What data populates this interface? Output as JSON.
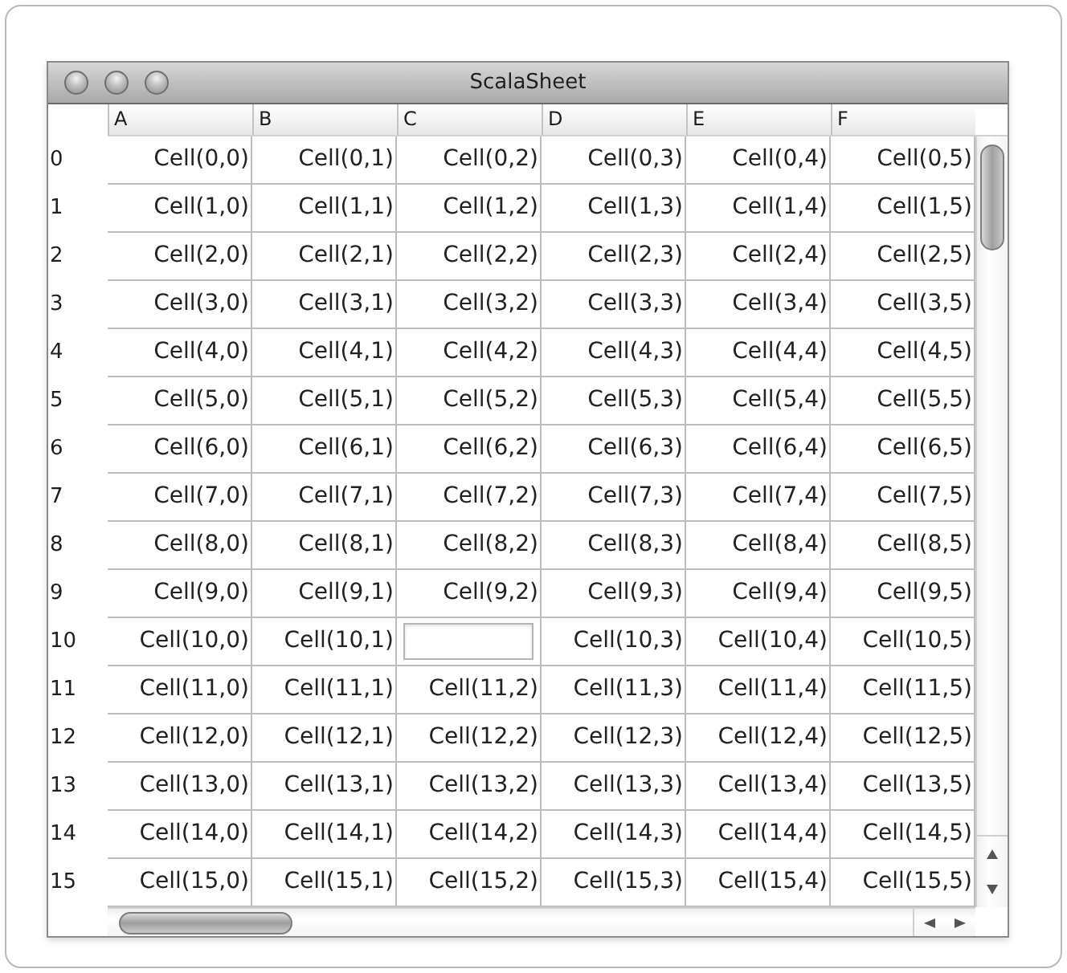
{
  "window": {
    "title": "ScalaSheet"
  },
  "columns": [
    "A",
    "B",
    "C",
    "D",
    "E",
    "F"
  ],
  "rows": [
    {
      "label": "0",
      "cells": [
        {
          "kind": "text",
          "text": "Cell(0,0)"
        },
        {
          "kind": "text",
          "text": "Cell(0,1)"
        },
        {
          "kind": "text",
          "text": "Cell(0,2)"
        },
        {
          "kind": "text",
          "text": "Cell(0,3)"
        },
        {
          "kind": "text",
          "text": "Cell(0,4)"
        },
        {
          "kind": "text",
          "text": "Cell(0,5)"
        }
      ]
    },
    {
      "label": "1",
      "cells": [
        {
          "kind": "text",
          "text": "Cell(1,0)"
        },
        {
          "kind": "text",
          "text": "Cell(1,1)"
        },
        {
          "kind": "text",
          "text": "Cell(1,2)"
        },
        {
          "kind": "text",
          "text": "Cell(1,3)"
        },
        {
          "kind": "text",
          "text": "Cell(1,4)"
        },
        {
          "kind": "text",
          "text": "Cell(1,5)"
        }
      ]
    },
    {
      "label": "2",
      "cells": [
        {
          "kind": "text",
          "text": "Cell(2,0)"
        },
        {
          "kind": "text",
          "text": "Cell(2,1)"
        },
        {
          "kind": "text",
          "text": "Cell(2,2)"
        },
        {
          "kind": "text",
          "text": "Cell(2,3)"
        },
        {
          "kind": "text",
          "text": "Cell(2,4)"
        },
        {
          "kind": "text",
          "text": "Cell(2,5)"
        }
      ]
    },
    {
      "label": "3",
      "cells": [
        {
          "kind": "text",
          "text": "Cell(3,0)"
        },
        {
          "kind": "text",
          "text": "Cell(3,1)"
        },
        {
          "kind": "text",
          "text": "Cell(3,2)"
        },
        {
          "kind": "text",
          "text": "Cell(3,3)"
        },
        {
          "kind": "text",
          "text": "Cell(3,4)"
        },
        {
          "kind": "text",
          "text": "Cell(3,5)"
        }
      ]
    },
    {
      "label": "4",
      "cells": [
        {
          "kind": "text",
          "text": "Cell(4,0)"
        },
        {
          "kind": "text",
          "text": "Cell(4,1)"
        },
        {
          "kind": "text",
          "text": "Cell(4,2)"
        },
        {
          "kind": "text",
          "text": "Cell(4,3)"
        },
        {
          "kind": "text",
          "text": "Cell(4,4)"
        },
        {
          "kind": "text",
          "text": "Cell(4,5)"
        }
      ]
    },
    {
      "label": "5",
      "cells": [
        {
          "kind": "text",
          "text": "Cell(5,0)"
        },
        {
          "kind": "text",
          "text": "Cell(5,1)"
        },
        {
          "kind": "text",
          "text": "Cell(5,2)"
        },
        {
          "kind": "text",
          "text": "Cell(5,3)"
        },
        {
          "kind": "text",
          "text": "Cell(5,4)"
        },
        {
          "kind": "text",
          "text": "Cell(5,5)"
        }
      ]
    },
    {
      "label": "6",
      "cells": [
        {
          "kind": "text",
          "text": "Cell(6,0)"
        },
        {
          "kind": "text",
          "text": "Cell(6,1)"
        },
        {
          "kind": "text",
          "text": "Cell(6,2)"
        },
        {
          "kind": "text",
          "text": "Cell(6,3)"
        },
        {
          "kind": "text",
          "text": "Cell(6,4)"
        },
        {
          "kind": "text",
          "text": "Cell(6,5)"
        }
      ]
    },
    {
      "label": "7",
      "cells": [
        {
          "kind": "text",
          "text": "Cell(7,0)"
        },
        {
          "kind": "text",
          "text": "Cell(7,1)"
        },
        {
          "kind": "text",
          "text": "Cell(7,2)"
        },
        {
          "kind": "text",
          "text": "Cell(7,3)"
        },
        {
          "kind": "text",
          "text": "Cell(7,4)"
        },
        {
          "kind": "text",
          "text": "Cell(7,5)"
        }
      ]
    },
    {
      "label": "8",
      "cells": [
        {
          "kind": "text",
          "text": "Cell(8,0)"
        },
        {
          "kind": "text",
          "text": "Cell(8,1)"
        },
        {
          "kind": "text",
          "text": "Cell(8,2)"
        },
        {
          "kind": "text",
          "text": "Cell(8,3)"
        },
        {
          "kind": "text",
          "text": "Cell(8,4)"
        },
        {
          "kind": "text",
          "text": "Cell(8,5)"
        }
      ]
    },
    {
      "label": "9",
      "cells": [
        {
          "kind": "text",
          "text": "Cell(9,0)"
        },
        {
          "kind": "text",
          "text": "Cell(9,1)"
        },
        {
          "kind": "text",
          "text": "Cell(9,2)"
        },
        {
          "kind": "text",
          "text": "Cell(9,3)"
        },
        {
          "kind": "text",
          "text": "Cell(9,4)"
        },
        {
          "kind": "text",
          "text": "Cell(9,5)"
        }
      ]
    },
    {
      "label": "10",
      "cells": [
        {
          "kind": "text",
          "text": "Cell(10,0)"
        },
        {
          "kind": "text",
          "text": "Cell(10,1)"
        },
        {
          "kind": "editor"
        },
        {
          "kind": "text",
          "text": "Cell(10,3)"
        },
        {
          "kind": "text",
          "text": "Cell(10,4)"
        },
        {
          "kind": "text",
          "text": "Cell(10,5)"
        }
      ]
    },
    {
      "label": "11",
      "cells": [
        {
          "kind": "text",
          "text": "Cell(11,0)"
        },
        {
          "kind": "text",
          "text": "Cell(11,1)"
        },
        {
          "kind": "text",
          "text": "Cell(11,2)"
        },
        {
          "kind": "text",
          "text": "Cell(11,3)"
        },
        {
          "kind": "text",
          "text": "Cell(11,4)"
        },
        {
          "kind": "text",
          "text": "Cell(11,5)"
        }
      ]
    },
    {
      "label": "12",
      "cells": [
        {
          "kind": "text",
          "text": "Cell(12,0)"
        },
        {
          "kind": "text",
          "text": "Cell(12,1)"
        },
        {
          "kind": "text",
          "text": "Cell(12,2)"
        },
        {
          "kind": "text",
          "text": "Cell(12,3)"
        },
        {
          "kind": "text",
          "text": "Cell(12,4)"
        },
        {
          "kind": "text",
          "text": "Cell(12,5)"
        }
      ]
    },
    {
      "label": "13",
      "cells": [
        {
          "kind": "text",
          "text": "Cell(13,0)"
        },
        {
          "kind": "text",
          "text": "Cell(13,1)"
        },
        {
          "kind": "text",
          "text": "Cell(13,2)"
        },
        {
          "kind": "text",
          "text": "Cell(13,3)"
        },
        {
          "kind": "text",
          "text": "Cell(13,4)"
        },
        {
          "kind": "text",
          "text": "Cell(13,5)"
        }
      ]
    },
    {
      "label": "14",
      "cells": [
        {
          "kind": "text",
          "text": "Cell(14,0)"
        },
        {
          "kind": "text",
          "text": "Cell(14,1)"
        },
        {
          "kind": "text",
          "text": "Cell(14,2)"
        },
        {
          "kind": "text",
          "text": "Cell(14,3)"
        },
        {
          "kind": "text",
          "text": "Cell(14,4)"
        },
        {
          "kind": "text",
          "text": "Cell(14,5)"
        }
      ]
    },
    {
      "label": "15",
      "cells": [
        {
          "kind": "text",
          "text": "Cell(15,0)"
        },
        {
          "kind": "text",
          "text": "Cell(15,1)"
        },
        {
          "kind": "text",
          "text": "Cell(15,2)"
        },
        {
          "kind": "text",
          "text": "Cell(15,3)"
        },
        {
          "kind": "text",
          "text": "Cell(15,4)"
        },
        {
          "kind": "text",
          "text": "Cell(15,5)"
        }
      ]
    }
  ]
}
